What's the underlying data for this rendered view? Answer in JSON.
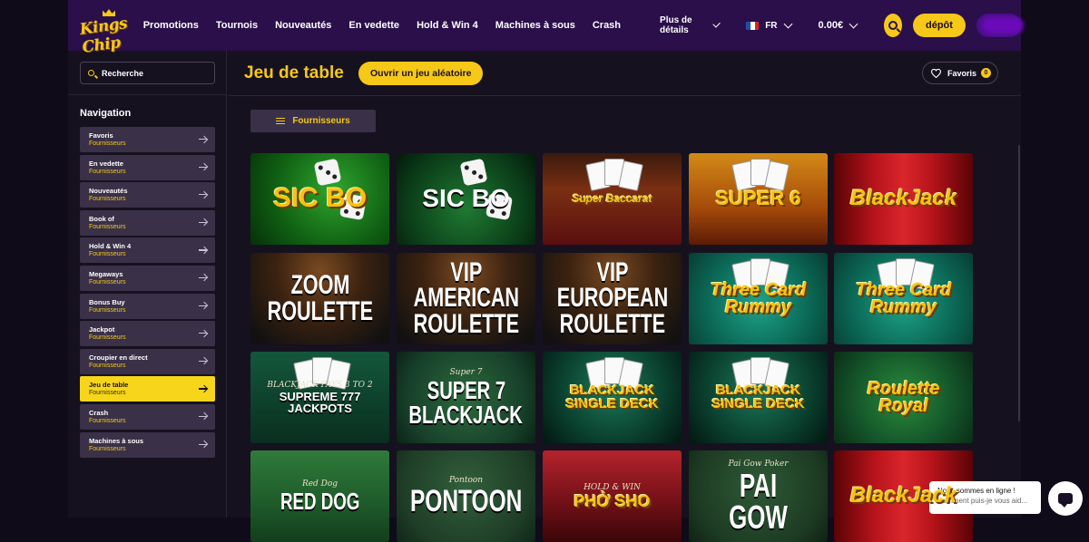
{
  "brand": {
    "logo_text": "Kings Chip"
  },
  "header": {
    "nav": [
      "Promotions",
      "Tournois",
      "Nouveautés",
      "En vedette",
      "Hold & Win 4",
      "Machines à sous",
      "Crash"
    ],
    "more_label": "Plus de détails",
    "lang": "FR",
    "balance": "0.00€",
    "deposit_label": "dépôt"
  },
  "sidebar": {
    "search_placeholder": "Recherche",
    "nav_title": "Navigation",
    "items": [
      {
        "label": "Favoris",
        "sub": "Fournisseurs",
        "active": false
      },
      {
        "label": "En vedette",
        "sub": "Fournisseurs",
        "active": false
      },
      {
        "label": "Nouveautés",
        "sub": "Fournisseurs",
        "active": false
      },
      {
        "label": "Book of",
        "sub": "Fournisseurs",
        "active": false
      },
      {
        "label": "Hold & Win 4",
        "sub": "Fournisseurs",
        "active": false
      },
      {
        "label": "Megaways",
        "sub": "Fournisseurs",
        "active": false
      },
      {
        "label": "Bonus Buy",
        "sub": "Fournisseurs",
        "active": false
      },
      {
        "label": "Jackpot",
        "sub": "Fournisseurs",
        "active": false
      },
      {
        "label": "Croupier en direct",
        "sub": "Fournisseurs",
        "active": false
      },
      {
        "label": "Jeu de table",
        "sub": "Fournisseurs",
        "active": true
      },
      {
        "label": "Crash",
        "sub": "Fournisseurs",
        "active": false
      },
      {
        "label": "Machines à sous",
        "sub": "Fournisseurs",
        "active": false
      }
    ]
  },
  "main": {
    "title": "Jeu de table",
    "random_button": "Ouvrir un jeu aléatoire",
    "favorites_label": "Favoris",
    "favorites_count": "0",
    "providers_button": "Fournisseurs"
  },
  "games": [
    {
      "top": "",
      "lines": [
        "SIC BO"
      ],
      "theme": "sicbo1"
    },
    {
      "top": "",
      "lines": [
        "SIC BO"
      ],
      "theme": "sicbo2"
    },
    {
      "top": "",
      "lines": [
        "Super Baccarat"
      ],
      "theme": "baccarat"
    },
    {
      "top": "",
      "lines": [
        "SUPER 6"
      ],
      "theme": "super6"
    },
    {
      "top": "",
      "lines": [
        "BlackJack"
      ],
      "theme": "bj-red"
    },
    {
      "top": "",
      "lines": [
        "ZOOM",
        "ROULETTE"
      ],
      "theme": "roulette"
    },
    {
      "top": "",
      "lines": [
        "VIP AMERICAN",
        "ROULETTE"
      ],
      "theme": "roulette"
    },
    {
      "top": "",
      "lines": [
        "VIP EUROPEAN",
        "ROULETTE"
      ],
      "theme": "roulette"
    },
    {
      "top": "",
      "lines": [
        "Three Card",
        "Rummy"
      ],
      "theme": "rummy"
    },
    {
      "top": "",
      "lines": [
        "Three Card",
        "Rummy"
      ],
      "theme": "rummy"
    },
    {
      "top": "BLACKJACK PAYS 3 TO 2",
      "lines": [
        "SUPREME 777",
        "JACKPOTS"
      ],
      "theme": "supreme"
    },
    {
      "top": "Super 7",
      "lines": [
        "SUPER 7",
        "BLACKJACK"
      ],
      "theme": "super7"
    },
    {
      "top": "",
      "lines": [
        "BLACKJACK",
        "SINGLE DECK"
      ],
      "theme": "bjsingle"
    },
    {
      "top": "",
      "lines": [
        "BLACKJACK",
        "SINGLE DECK"
      ],
      "theme": "bjsingle"
    },
    {
      "top": "",
      "lines": [
        "Roulette",
        "Royal"
      ],
      "theme": "royal"
    },
    {
      "top": "Red Dog",
      "lines": [
        "RED DOG"
      ],
      "theme": "reddog"
    },
    {
      "top": "Pontoon",
      "lines": [
        "PONTOON"
      ],
      "theme": "pontoon"
    },
    {
      "top": "HOLD & WIN",
      "lines": [
        "PHỞ SHO"
      ],
      "theme": "phosho"
    },
    {
      "top": "Pai Gow Poker",
      "lines": [
        "PAI GOW"
      ],
      "theme": "paigow"
    },
    {
      "top": "",
      "lines": [
        "BlackJack"
      ],
      "theme": "bj-red"
    }
  ],
  "chat": {
    "line1": "Nous sommes en ligne !",
    "line2": "Comment puis-je vous aid..."
  }
}
